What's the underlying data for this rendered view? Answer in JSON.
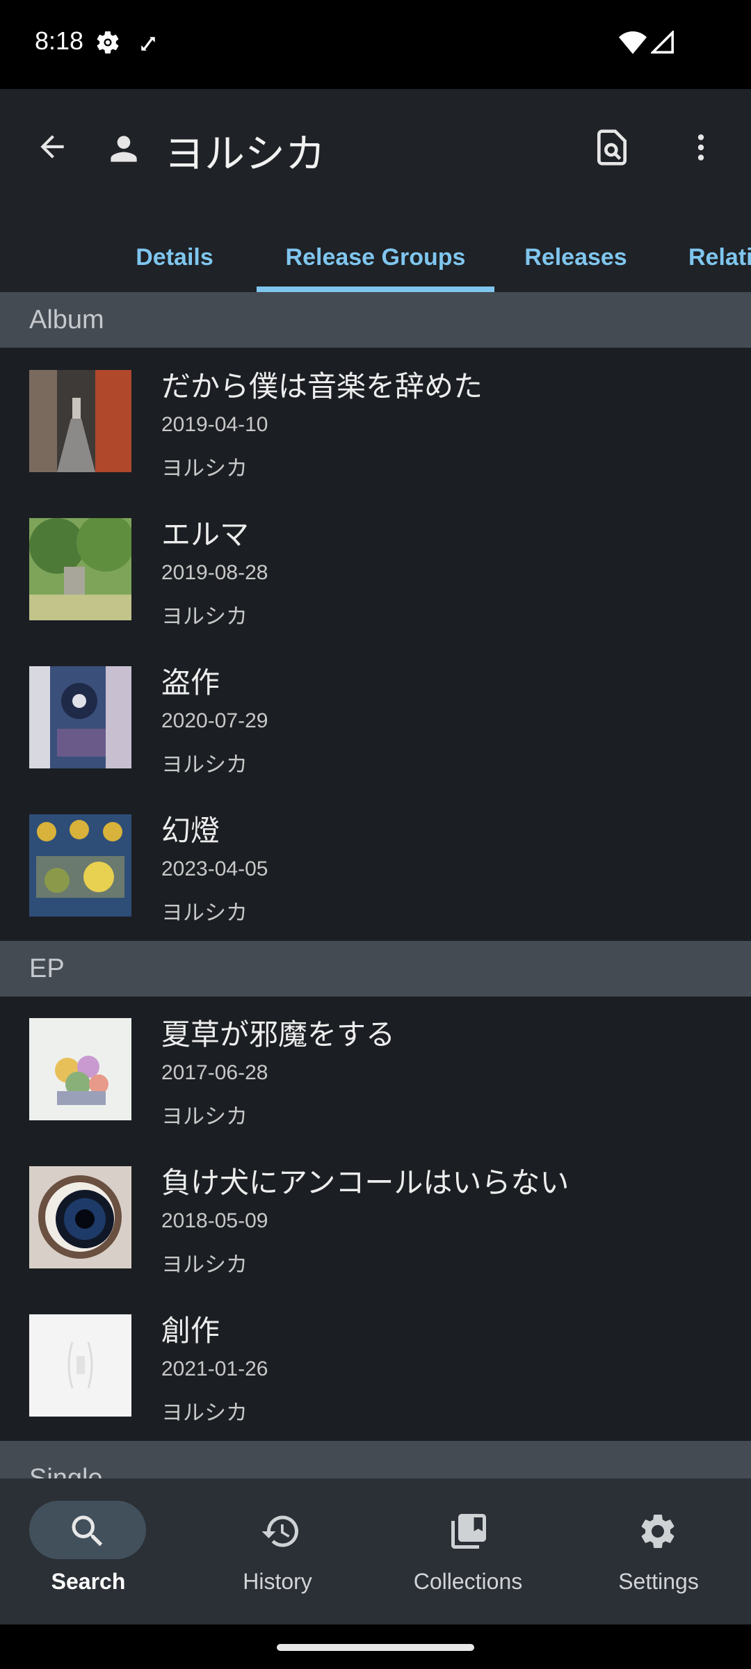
{
  "status_bar": {
    "time": "8:18"
  },
  "app_bar": {
    "title": "ヨルシカ"
  },
  "tabs": [
    {
      "label": "Details"
    },
    {
      "label": "Release Groups"
    },
    {
      "label": "Releases"
    },
    {
      "label": "Relati"
    }
  ],
  "active_tab": "Release Groups",
  "sections": {
    "album": {
      "header": "Album",
      "items": [
        {
          "title": "だから僕は音楽を辞めた",
          "date": "2019-04-10",
          "artist": "ヨルシカ"
        },
        {
          "title": "エルマ",
          "date": "2019-08-28",
          "artist": "ヨルシカ"
        },
        {
          "title": "盗作",
          "date": "2020-07-29",
          "artist": "ヨルシカ"
        },
        {
          "title": "幻燈",
          "date": "2023-04-05",
          "artist": "ヨルシカ"
        }
      ]
    },
    "ep": {
      "header": "EP",
      "items": [
        {
          "title": "夏草が邪魔をする",
          "date": "2017-06-28",
          "artist": "ヨルシカ"
        },
        {
          "title": "負け犬にアンコールはいらない",
          "date": "2018-05-09",
          "artist": "ヨルシカ"
        },
        {
          "title": "創作",
          "date": "2021-01-26",
          "artist": "ヨルシカ"
        }
      ]
    },
    "single": {
      "header": "Single"
    }
  },
  "bottom_nav": [
    {
      "label": "Search",
      "icon": "search-icon",
      "active": true
    },
    {
      "label": "History",
      "icon": "history-icon",
      "active": false
    },
    {
      "label": "Collections",
      "icon": "collections-icon",
      "active": false
    },
    {
      "label": "Settings",
      "icon": "settings-icon",
      "active": false
    }
  ],
  "colors": {
    "accent": "#7fc6ef",
    "background": "#1b1e22",
    "section_header": "#454b52",
    "nav_background": "#2b3036"
  }
}
